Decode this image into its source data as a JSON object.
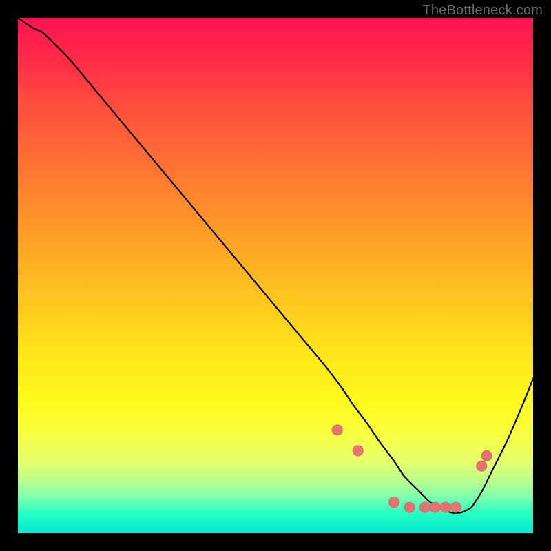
{
  "attribution": "TheBottleneck.com",
  "colors": {
    "curve_stroke": "#000000",
    "marker_fill": "#e57373",
    "marker_stroke": "#d86262",
    "gradient_top": "#ff1452",
    "gradient_mid": "#ffe81a",
    "gradient_bottom": "#00e8d0",
    "page_bg": "#000000"
  },
  "chart_data": {
    "type": "line",
    "title": "",
    "xlabel": "",
    "ylabel": "",
    "xlim": [
      0,
      100
    ],
    "ylim": [
      0,
      100
    ],
    "series": [
      {
        "name": "curve",
        "x": [
          0,
          3,
          5,
          10,
          15,
          20,
          25,
          30,
          35,
          40,
          45,
          50,
          55,
          60,
          63,
          65,
          68,
          70,
          73,
          75,
          78,
          80,
          82,
          84,
          86,
          88,
          90,
          92,
          95,
          98,
          100
        ],
        "y": [
          100,
          98,
          97,
          92,
          86,
          80,
          74,
          68,
          62,
          56,
          50,
          44,
          38,
          32,
          28,
          25,
          21,
          18,
          14,
          11,
          8,
          6,
          5,
          4,
          4,
          5,
          8,
          12,
          18,
          25,
          30
        ]
      }
    ],
    "markers": {
      "name": "highlight-points",
      "x": [
        62,
        66,
        73,
        76,
        79,
        81,
        83,
        85,
        90,
        91
      ],
      "y": [
        20,
        16,
        6,
        5,
        5,
        5,
        5,
        5,
        13,
        15
      ]
    }
  }
}
